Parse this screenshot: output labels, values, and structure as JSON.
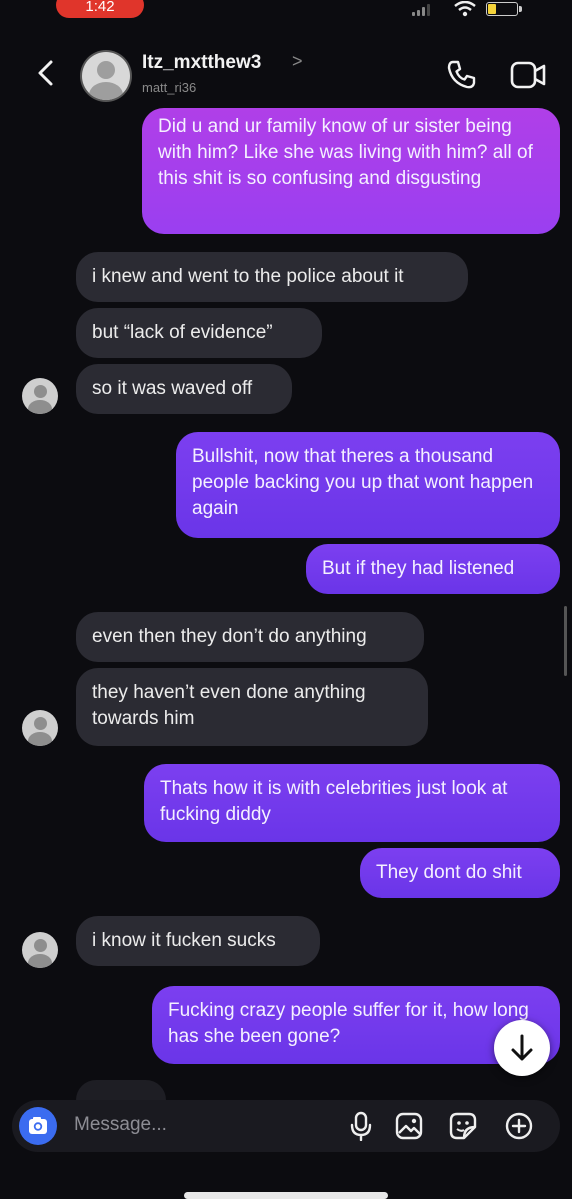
{
  "status_bar": {
    "time": "1:42"
  },
  "header": {
    "username": "Itz_mxtthew3",
    "chevron": ">",
    "handle": "matt_ri36",
    "icons": [
      "back-icon",
      "phone-icon",
      "video-icon"
    ]
  },
  "messages": [
    {
      "side": "out",
      "text": "Did u and ur family know of ur sister being with him? Like she was living with him? all of this shit is so confusing and disgusting"
    },
    {
      "side": "in",
      "text": "i knew and went to the police about it"
    },
    {
      "side": "in",
      "text": "but “lack of evidence”"
    },
    {
      "side": "in",
      "text": "so it was waved off"
    },
    {
      "side": "out",
      "text": "Bullshit, now that theres a thousand people backing you up that wont happen again"
    },
    {
      "side": "out",
      "text": "But if they had listened"
    },
    {
      "side": "in",
      "text": "even then they don’t do anything"
    },
    {
      "side": "in",
      "text": "they haven’t even done anything towards him"
    },
    {
      "side": "out",
      "text": "Thats how it is with celebrities just look at fucking diddy"
    },
    {
      "side": "out",
      "text": "They dont do shit"
    },
    {
      "side": "in",
      "text": "i know it fucken sucks"
    },
    {
      "side": "out",
      "text": "Fucking crazy people suffer for it, how long has she been gone?"
    }
  ],
  "composer": {
    "placeholder": "Message...",
    "icons": [
      "camera-icon",
      "microphone-icon",
      "gallery-icon",
      "sticker-icon",
      "plus-icon"
    ]
  },
  "colors": {
    "outgoing": "#6a35e8",
    "outgoing_top": "#9a3ff0",
    "incoming": "#2b2b33",
    "background": "#0c0c10",
    "camera_button": "#3b6cf0"
  }
}
